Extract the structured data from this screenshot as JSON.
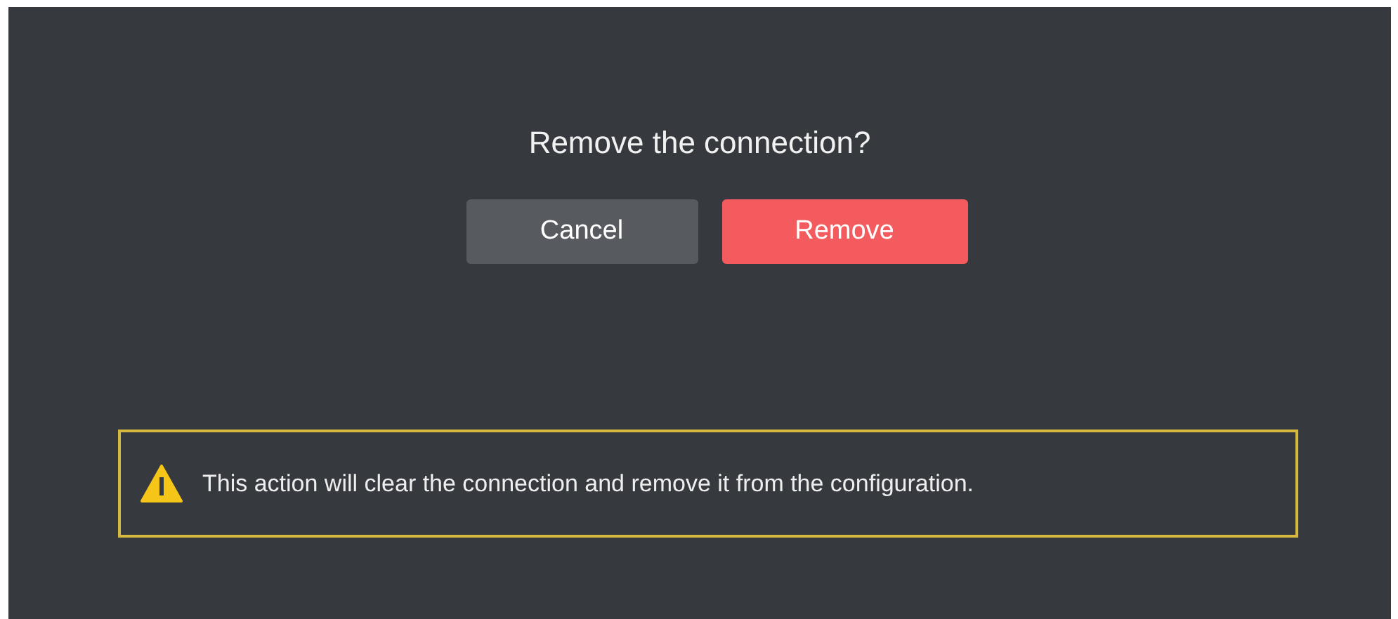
{
  "dialog": {
    "title": "Remove the connection?",
    "buttons": [
      {
        "label": "Cancel",
        "kind": "secondary"
      },
      {
        "label": "Remove",
        "kind": "danger"
      }
    ]
  },
  "warning": {
    "text": "This action will clear the connection and remove it from the configuration."
  }
}
